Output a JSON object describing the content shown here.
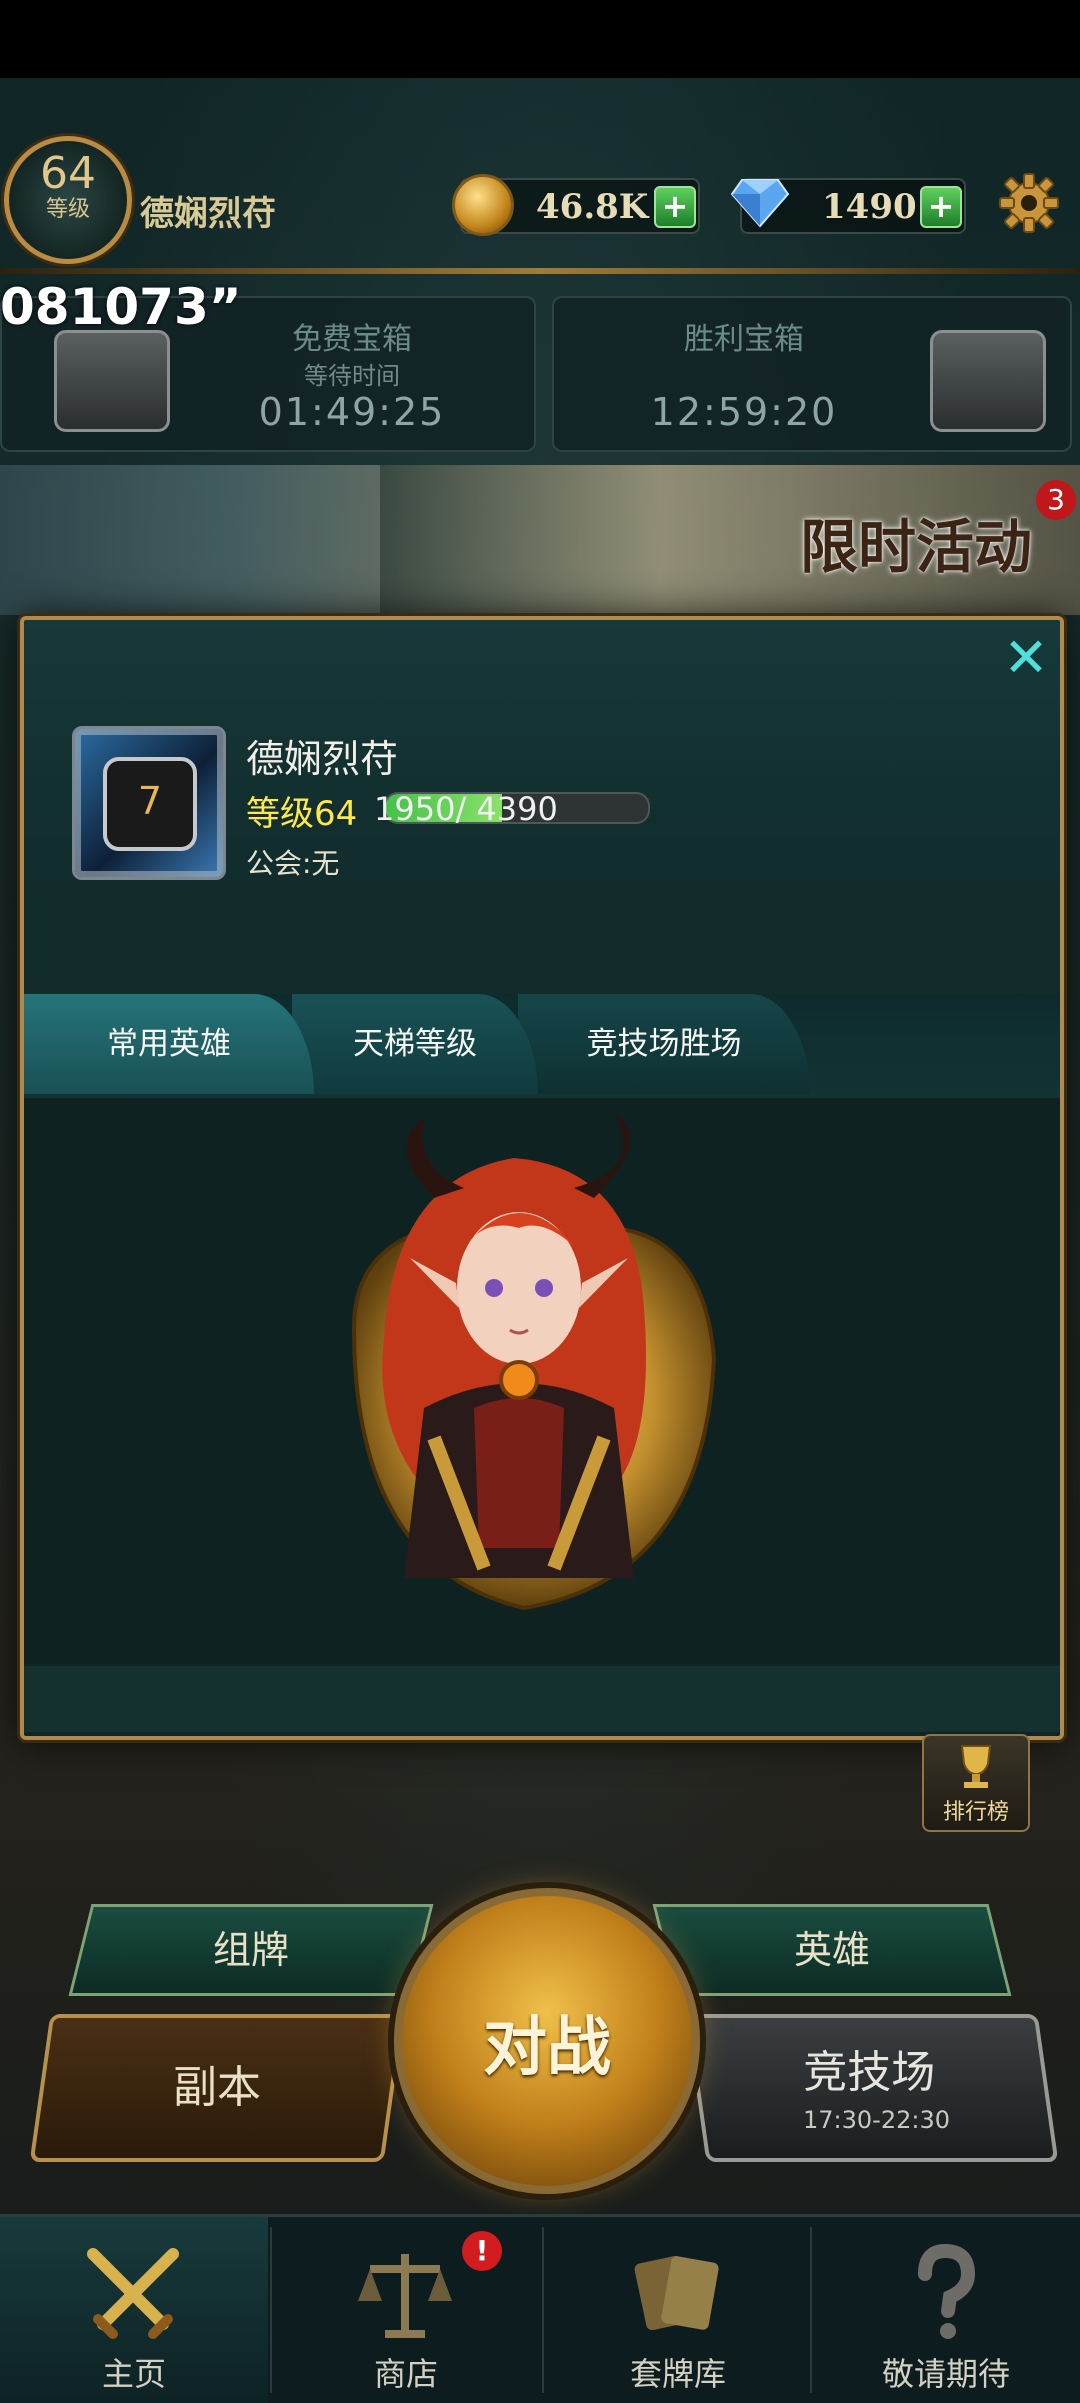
{
  "hud": {
    "level_number": "64",
    "level_caption": "等级",
    "player_name": "德娴烈苻",
    "gold": "46.8K",
    "gems": "1490",
    "plus": "+"
  },
  "overlay_code": "081073”",
  "chests": {
    "free": {
      "title": "免费宝箱",
      "subtitle": "等待时间",
      "time": "01:49:25"
    },
    "victory": {
      "title": "胜利宝箱",
      "time": "12:59:20"
    }
  },
  "event": {
    "title": "限时活动",
    "badge": "3"
  },
  "profile": {
    "close": "✕",
    "avatar_level": "7",
    "name": "德娴烈苻",
    "level_label": "等级64",
    "xp": "1950/ 4390",
    "xp_fraction": 0.444,
    "guild": "公会:无",
    "tabs": [
      "常用英雄",
      "天梯等级",
      "竞技场胜场"
    ]
  },
  "menu": {
    "ranking": "排行榜",
    "deck": "组牌",
    "hero": "英雄",
    "dungeon": "副本",
    "battle": "对战",
    "arena": "竞技场",
    "arena_time": "17:30-22:30"
  },
  "nav": {
    "items": [
      "主页",
      "商店",
      "套牌库",
      "敬请期待"
    ],
    "shop_badge": "!"
  },
  "colors": {
    "accent_teal": "#3ea5a4",
    "gold_border": "#b08a50",
    "level_yellow": "#ffe84a"
  }
}
